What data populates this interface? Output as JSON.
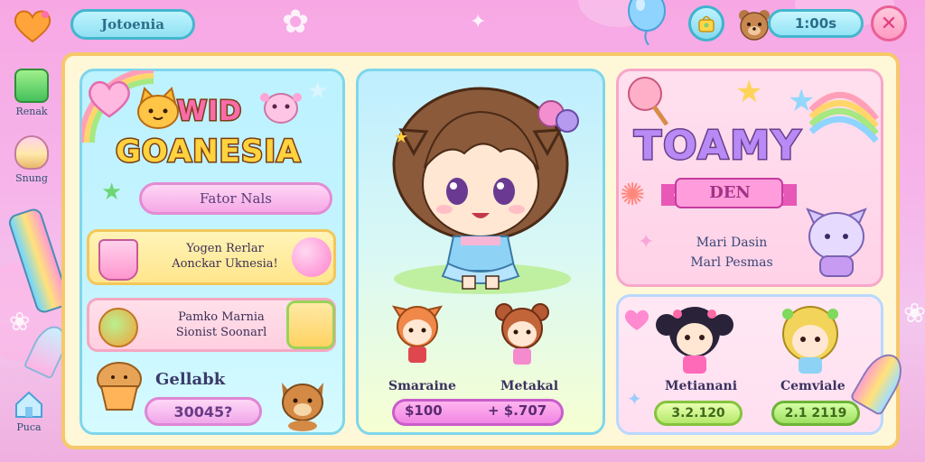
{
  "header": {
    "title": "Jotoenia",
    "timer": "1:00s",
    "close_symbol": "✕"
  },
  "sidebar": {
    "items": [
      {
        "label": "Renak",
        "icon": "battery-icon"
      },
      {
        "label": "Snung",
        "icon": "ice-cream-icon"
      }
    ],
    "home_label": "Puca"
  },
  "left_panel": {
    "logo_top": "WID",
    "logo_bottom": "GOANESIA",
    "button_label": "Fator Nals",
    "card1_lines": [
      "Yogen Rerlar",
      "Aonckar Uknesia!"
    ],
    "card2_lines": [
      "Pamko Marnia",
      "Sionist Soonarl"
    ],
    "gold_label": "Gellabk",
    "gold_value": "30045?"
  },
  "middle_panel": {
    "characters": [
      {
        "name": "Smaraine"
      },
      {
        "name": "Metakal"
      }
    ],
    "price_left": "$100",
    "price_right": "+ $.707"
  },
  "right_top": {
    "title": "TOAMY",
    "ribbon": "DEN",
    "desc_lines": [
      "Mari Dasin",
      "Marl Pesmas"
    ]
  },
  "right_bottom": {
    "characters": [
      {
        "name": "Metianani",
        "price": "3.2.120"
      },
      {
        "name": "Cemviale",
        "price": "2.1 2119"
      }
    ]
  },
  "colors": {
    "background": "#f6b4ea",
    "frame": "#fff8d8",
    "accent_cyan": "#7fd6ec",
    "accent_pink": "#f285e4"
  }
}
